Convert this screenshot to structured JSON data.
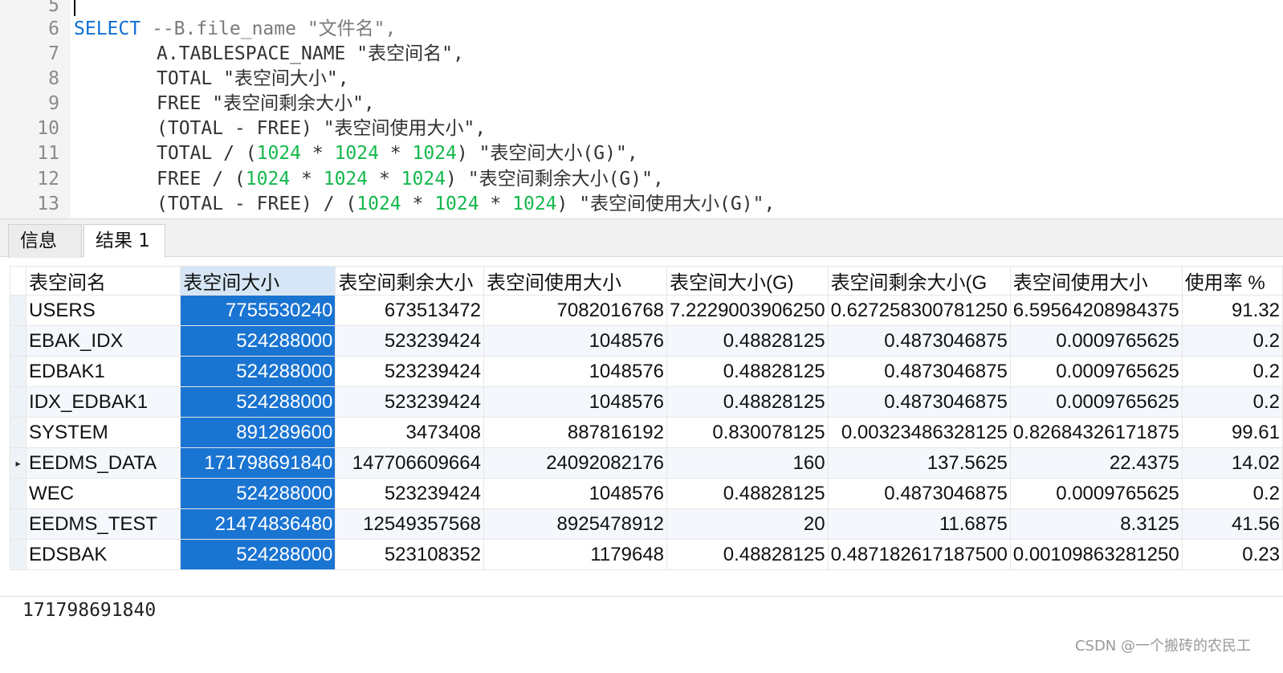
{
  "editor": {
    "lines": [
      {
        "num": "5",
        "tokens": []
      },
      {
        "num": "6",
        "tokens": [
          {
            "t": "SELECT",
            "c": "kw"
          },
          {
            "t": " ",
            "c": "str"
          },
          {
            "t": "--B.file_name \"文件名\",",
            "c": "cm"
          }
        ]
      },
      {
        "num": "7",
        "tokens": [
          {
            "t": "A.TABLESPACE_NAME \"表空间名\",",
            "c": "str"
          }
        ]
      },
      {
        "num": "8",
        "tokens": [
          {
            "t": "TOTAL \"表空间大小\",",
            "c": "str"
          }
        ]
      },
      {
        "num": "9",
        "tokens": [
          {
            "t": "FREE \"表空间剩余大小\",",
            "c": "str"
          }
        ]
      },
      {
        "num": "10",
        "tokens": [
          {
            "t": "(TOTAL - FREE) \"表空间使用大小\",",
            "c": "str"
          }
        ]
      },
      {
        "num": "11",
        "tokens": [
          {
            "t": "TOTAL / (",
            "c": "str"
          },
          {
            "t": "1024",
            "c": "num"
          },
          {
            "t": " * ",
            "c": "str"
          },
          {
            "t": "1024",
            "c": "num"
          },
          {
            "t": " * ",
            "c": "str"
          },
          {
            "t": "1024",
            "c": "num"
          },
          {
            "t": ") \"表空间大小(G)\",",
            "c": "str"
          }
        ]
      },
      {
        "num": "12",
        "tokens": [
          {
            "t": "FREE / (",
            "c": "str"
          },
          {
            "t": "1024",
            "c": "num"
          },
          {
            "t": " * ",
            "c": "str"
          },
          {
            "t": "1024",
            "c": "num"
          },
          {
            "t": " * ",
            "c": "str"
          },
          {
            "t": "1024",
            "c": "num"
          },
          {
            "t": ") \"表空间剩余大小(G)\",",
            "c": "str"
          }
        ]
      },
      {
        "num": "13",
        "tokens": [
          {
            "t": "(TOTAL - FREE) / (",
            "c": "str"
          },
          {
            "t": "1024",
            "c": "num"
          },
          {
            "t": " * ",
            "c": "str"
          },
          {
            "t": "1024",
            "c": "num"
          },
          {
            "t": " * ",
            "c": "str"
          },
          {
            "t": "1024",
            "c": "num"
          },
          {
            "t": ") \"表空间使用大小(G)\",",
            "c": "str"
          }
        ]
      }
    ]
  },
  "tabs": {
    "info": "信息",
    "result": "结果 1"
  },
  "grid": {
    "columns": [
      "表空间名",
      "表空间大小",
      "表空间剩余大小",
      "表空间使用大小",
      "表空间大小(G)",
      "表空间剩余大小(G",
      "表空间使用大小",
      "使用率 %"
    ],
    "rows": [
      [
        "USERS",
        "7755530240",
        "673513472",
        "7082016768",
        "7.2229003906250",
        "0.627258300781250",
        "6.59564208984375",
        "91.32"
      ],
      [
        "EBAK_IDX",
        "524288000",
        "523239424",
        "1048576",
        "0.48828125",
        "0.4873046875",
        "0.0009765625",
        "0.2"
      ],
      [
        "EDBAK1",
        "524288000",
        "523239424",
        "1048576",
        "0.48828125",
        "0.4873046875",
        "0.0009765625",
        "0.2"
      ],
      [
        "IDX_EDBAK1",
        "524288000",
        "523239424",
        "1048576",
        "0.48828125",
        "0.4873046875",
        "0.0009765625",
        "0.2"
      ],
      [
        "SYSTEM",
        "891289600",
        "3473408",
        "887816192",
        "0.830078125",
        "0.00323486328125",
        "0.82684326171875",
        "99.61"
      ],
      [
        "EEDMS_DATA",
        "171798691840",
        "147706609664",
        "24092082176",
        "160",
        "137.5625",
        "22.4375",
        "14.02"
      ],
      [
        "WEC",
        "524288000",
        "523239424",
        "1048576",
        "0.48828125",
        "0.4873046875",
        "0.0009765625",
        "0.2"
      ],
      [
        "EEDMS_TEST",
        "21474836480",
        "12549357568",
        "8925478912",
        "20",
        "11.6875",
        "8.3125",
        "41.56"
      ],
      [
        "EDSBAK",
        "524288000",
        "523108352",
        "1179648",
        "0.48828125",
        "0.487182617187500",
        "0.00109863281250",
        "0.23"
      ]
    ],
    "current_row_marker": "▸",
    "current_row_index": 5
  },
  "status": {
    "selected_value": "171798691840"
  },
  "watermark": "CSDN @一个搬砖的农民工"
}
